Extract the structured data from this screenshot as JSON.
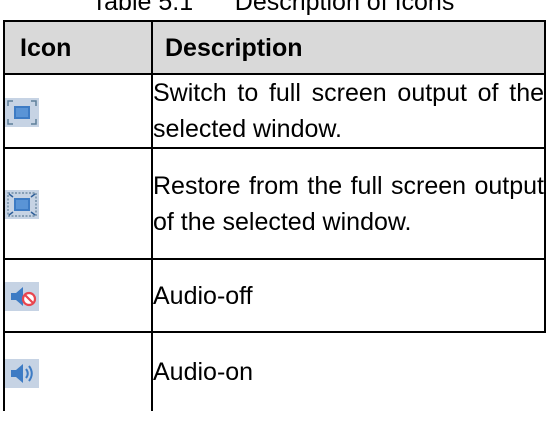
{
  "caption": "Table 5.1      Description of Icons",
  "table": {
    "header_icon": "Icon",
    "header_description": "Description",
    "rows": [
      {
        "icon": "fullscreen-icon",
        "description": "Switch to full screen output of the selected window."
      },
      {
        "icon": "restore-fullscreen-icon",
        "description": "Restore from the full screen output of the selected window."
      },
      {
        "icon": "audio-off-icon",
        "description": "Audio-off"
      },
      {
        "icon": "audio-on-icon",
        "description": "Audio-on"
      }
    ]
  },
  "colors": {
    "header_background": "#d9d9d9",
    "icon_background": "#c6d3e4",
    "icon_blue": "#3d7bc4",
    "audio_off_badge": "#e8464f"
  }
}
